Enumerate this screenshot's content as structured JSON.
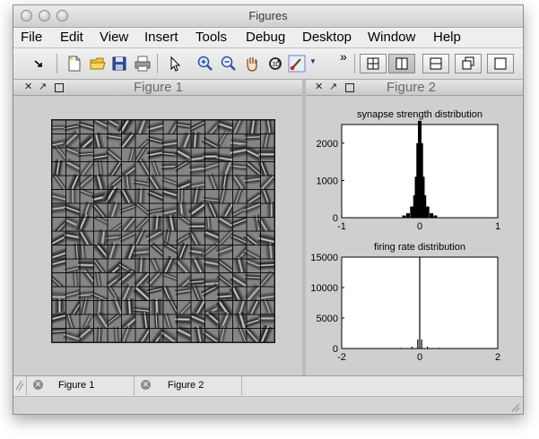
{
  "window": {
    "title": "Figures"
  },
  "menu": [
    "File",
    "Edit",
    "View",
    "Insert",
    "Tools",
    "Debug",
    "Desktop",
    "Window",
    "Help"
  ],
  "toolbar": {
    "tools": [
      "dock-arrow-icon",
      "new-figure-icon",
      "open-folder-icon",
      "save-icon",
      "print-icon",
      "pointer-icon",
      "zoom-in-icon",
      "zoom-out-icon",
      "pan-hand-icon",
      "rotate-3d-icon",
      "brush-icon"
    ],
    "overflow": "»",
    "layout_selected": "left-right"
  },
  "panels": {
    "figure1": {
      "title": "Figure 1"
    },
    "figure2": {
      "title": "Figure 2"
    }
  },
  "tabs": [
    {
      "label": "Figure 1"
    },
    {
      "label": "Figure 2"
    }
  ],
  "chart_data": [
    {
      "type": "bar",
      "title": "synapse strength distribution",
      "xlabel": "",
      "ylabel": "",
      "xlim": [
        -1,
        1
      ],
      "ylim": [
        0,
        2500
      ],
      "xticks": [
        "-1",
        "0",
        "1"
      ],
      "yticks": [
        "0",
        "1000",
        "2000"
      ],
      "x": [
        -0.2,
        -0.15,
        -0.1,
        -0.06,
        -0.04,
        -0.02,
        0,
        0.02,
        0.04,
        0.06,
        0.1,
        0.15,
        0.2
      ],
      "values": [
        60,
        120,
        300,
        600,
        1100,
        2000,
        2600,
        2000,
        1100,
        600,
        300,
        120,
        60
      ]
    },
    {
      "type": "bar",
      "title": "firing rate distribution",
      "xlabel": "",
      "ylabel": "",
      "xlim": [
        -2,
        2
      ],
      "ylim": [
        0,
        15000
      ],
      "xticks": [
        "-2",
        "0",
        "2"
      ],
      "yticks": [
        "0",
        "5000",
        "10000",
        "15000"
      ],
      "x": [
        -1.0,
        -0.5,
        -0.2,
        -0.05,
        0,
        0.05,
        0.2,
        0.5,
        1.0
      ],
      "values": [
        40,
        120,
        300,
        1500,
        15000,
        1500,
        300,
        120,
        40
      ]
    }
  ]
}
